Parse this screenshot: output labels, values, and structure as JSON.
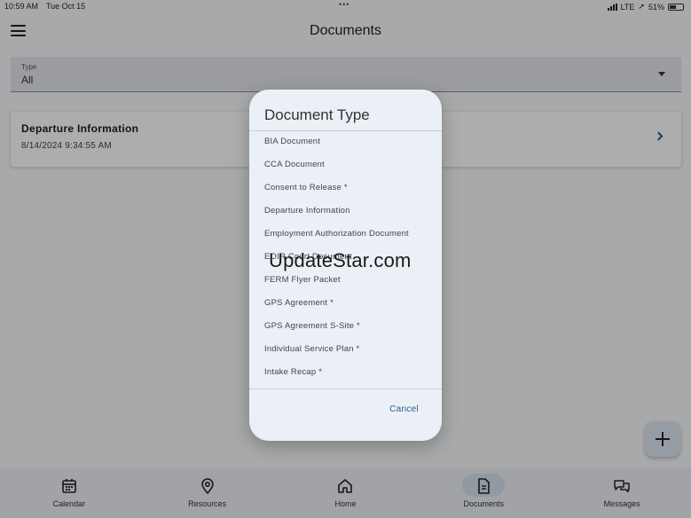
{
  "status_bar": {
    "time": "10:59 AM",
    "date": "Tue Oct 15",
    "network": "LTE",
    "battery": "51%"
  },
  "header": {
    "title": "Documents",
    "menu_icon": "hamburger-menu-icon"
  },
  "filter": {
    "label": "Type",
    "value": "All"
  },
  "documents": [
    {
      "title": "Departure Information",
      "date": "8/14/2024 9:34:55 AM"
    }
  ],
  "dialog": {
    "title": "Document Type",
    "options": [
      "BIA Document",
      "CCA Document",
      "Consent to Release *",
      "Departure Information",
      "Employment Authorization Document",
      "EOIR Court Document",
      "FERM Flyer Packet",
      "GPS Agreement *",
      "GPS Agreement S-Site *",
      "Individual Service Plan *",
      "Intake Recap *"
    ],
    "cancel_label": "Cancel"
  },
  "watermark": "UpdateStar.com",
  "bottom_nav": [
    {
      "label": "Calendar",
      "icon": "calendar-icon"
    },
    {
      "label": "Resources",
      "icon": "location-pin-icon"
    },
    {
      "label": "Home",
      "icon": "home-icon"
    },
    {
      "label": "Documents",
      "icon": "document-icon",
      "active": true
    },
    {
      "label": "Messages",
      "icon": "chat-bubbles-icon"
    }
  ],
  "colors": {
    "accent": "#2b5d8c",
    "dialog_bg": "#eaf0f6",
    "scrim": "rgba(0,0,0,0.32)"
  }
}
